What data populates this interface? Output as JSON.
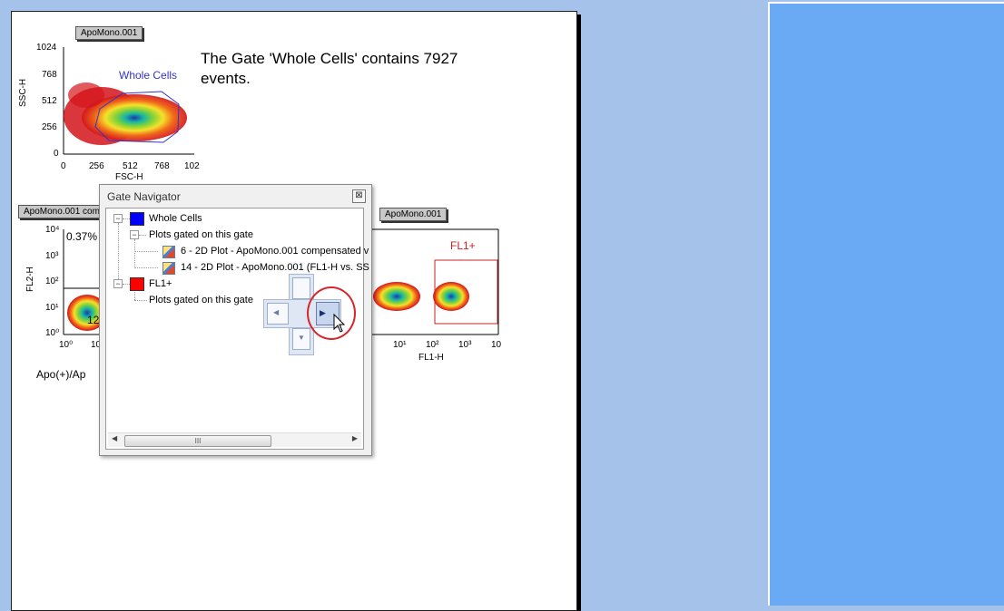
{
  "plot1": {
    "tag": "ApoMono.001",
    "xlabel": "FSC-H",
    "ylabel": "SSC-H",
    "xticks": [
      "0",
      "256",
      "512",
      "768",
      "102"
    ],
    "yticks": [
      "1024",
      "768",
      "512",
      "256",
      "0"
    ],
    "gate_label": "Whole Cells"
  },
  "gate_message": "The Gate 'Whole Cells' contains 7927 events.",
  "plot2": {
    "tag": "ApoMono.001 com",
    "ylabel": "FL2-H",
    "yticks": [
      "10⁴",
      "10³",
      "10²",
      "10¹",
      "10⁰"
    ],
    "xticks": [
      "10⁰",
      "10"
    ],
    "percent_label": "0.37%",
    "quad_label": "12"
  },
  "plot3": {
    "tag": "ApoMono.001",
    "xlabel": "FL1-H",
    "xticks": [
      "10¹",
      "10²",
      "10³",
      "10"
    ],
    "gate_label": "FL1+"
  },
  "below_label": "Apo(+)/Ap",
  "navigator": {
    "title": "Gate Navigator",
    "close_symbol": "⊠",
    "tree": {
      "gate1": "Whole Cells",
      "gate1_child": "Plots gated on this gate",
      "plot_a": "6 - 2D Plot - ApoMono.001 compensated v",
      "plot_b": "14 - 2D Plot - ApoMono.001 (FL1-H vs. SS",
      "gate2": "FL1+",
      "gate2_child": "Plots gated on this gate"
    },
    "scroll_thumb": "III"
  },
  "colors": {
    "gate1_swatch": "#0000ff",
    "gate2_swatch": "#ff0000",
    "gate_outline_blue": "#3333cc",
    "gate_outline_red": "#cc2222",
    "highlight": "#d8242a"
  }
}
